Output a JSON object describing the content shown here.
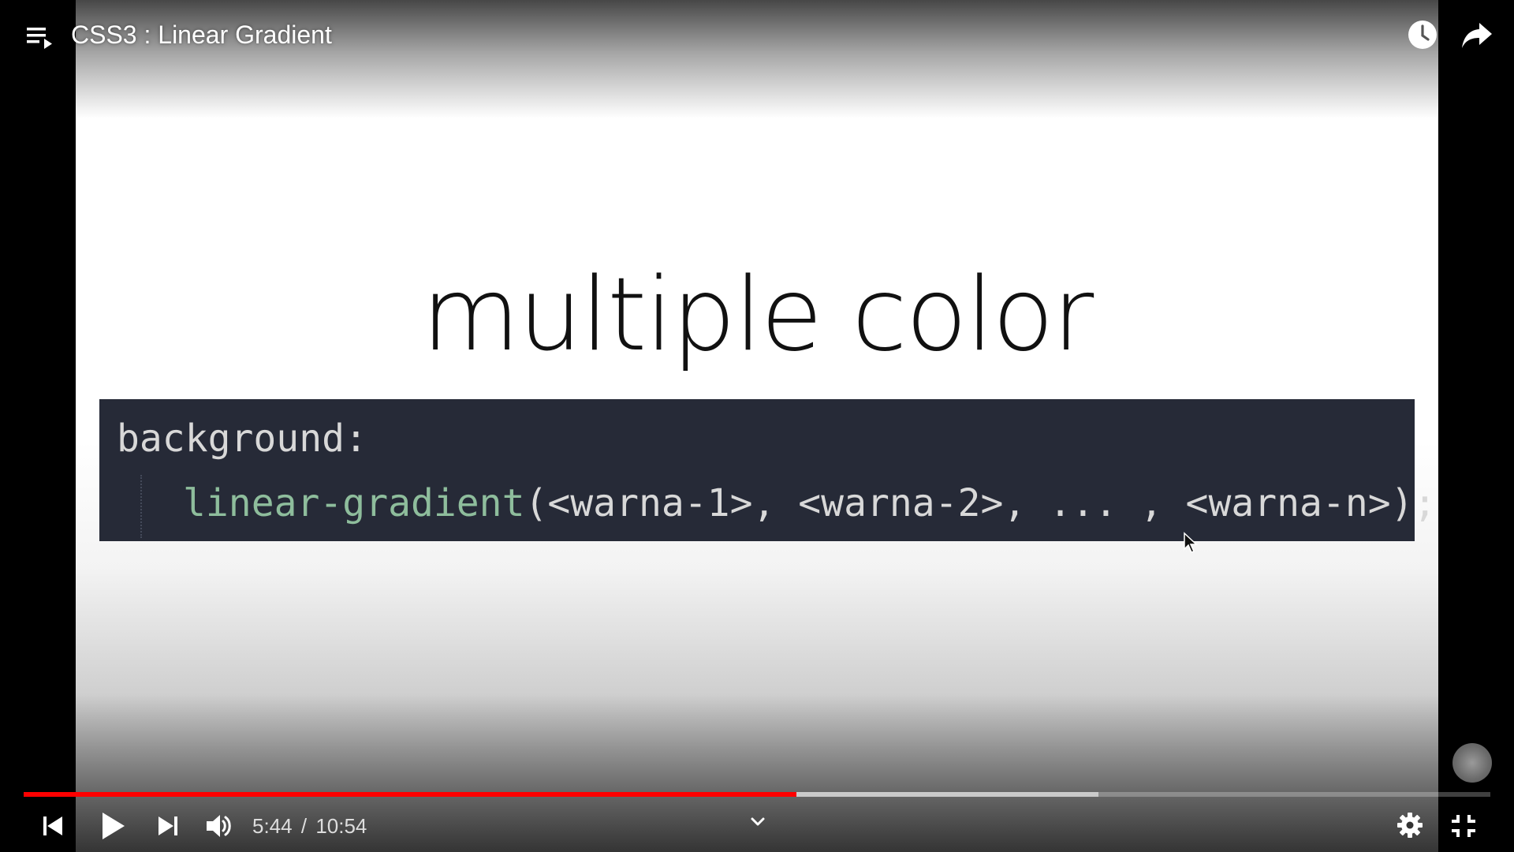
{
  "header": {
    "video_title": "CSS3 : Linear Gradient"
  },
  "slide": {
    "title": "multiple color",
    "code_line_1": "background:",
    "code_line_2_fn": "linear-gradient",
    "code_line_2_args": "(<warna-1>, <warna-2>, ... , <warna-n>);"
  },
  "player": {
    "current_time": "5:44",
    "time_separator": "/",
    "duration": "10:54",
    "progress_played_fraction": 0.527,
    "progress_buffered_fraction": 0.733,
    "accent_color": "#ff0000"
  },
  "icons": {
    "playlist": "playlist-icon",
    "watch_later": "clock-icon",
    "share": "share-arrow-icon",
    "previous": "skip-previous-icon",
    "play": "play-icon",
    "next": "skip-next-icon",
    "volume": "volume-icon",
    "expand": "chevron-down-icon",
    "settings": "gear-icon",
    "exit_fullscreen": "exit-fullscreen-icon"
  }
}
